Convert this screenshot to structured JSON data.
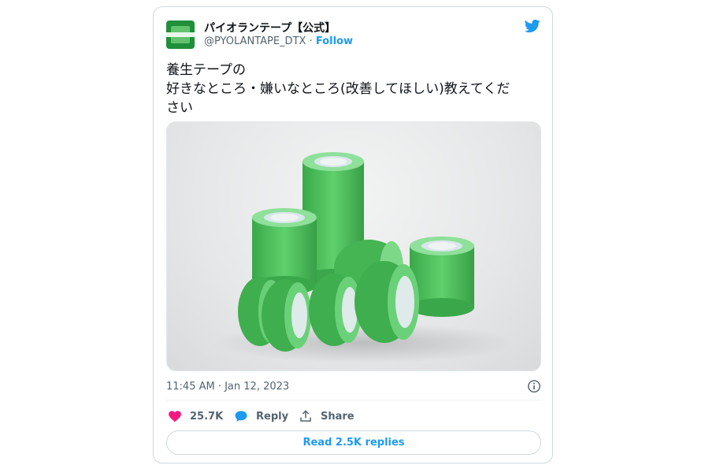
{
  "tweet": {
    "author": {
      "display_name": "パイオランテープ【公式】",
      "handle": "@PYOLANTAPE_DTX",
      "separator": " · ",
      "follow_label": "Follow"
    },
    "text": "養生テープの\n好きなところ・嫌いなところ(改善してほしい)教えてくだ\nさい",
    "timestamp": "11:45 AM · Jan 12, 2023",
    "likes": "25.7K",
    "reply_label": "Reply",
    "share_label": "Share",
    "read_replies_label": "Read 2.5K replies",
    "media_description": "green tape rolls",
    "colors": {
      "accent": "#1d9bf0",
      "like": "#f91880",
      "tape_green": "#4cc259"
    },
    "icons": [
      "twitter-bird-icon",
      "info-icon",
      "heart-icon",
      "reply-bubble-icon",
      "share-icon"
    ]
  }
}
